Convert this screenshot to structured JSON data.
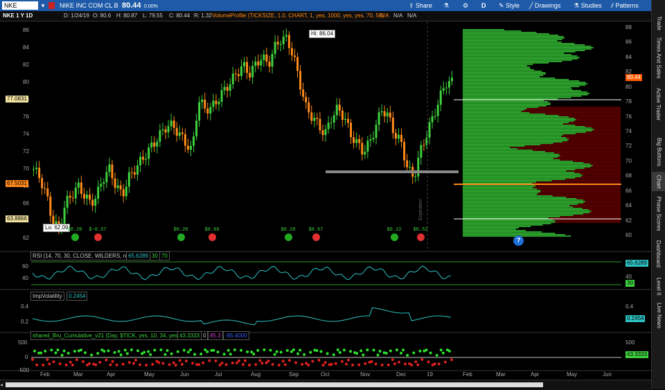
{
  "toolbar": {
    "symbol": "NKE",
    "company": "NIKE INC COM CL B",
    "last": "80.44",
    "change": "0.00%",
    "share": "Share",
    "d": "D",
    "style": "Style",
    "drawings": "Drawings",
    "studies": "Studies",
    "patterns": "Patterns"
  },
  "info": {
    "period": "NKE 1 Y 1D",
    "date": "D: 1/24/19",
    "open": "O: 80.6",
    "high": "H: 80.87",
    "low": "L: 79.55",
    "close": "C: 80.44",
    "range": "R: 1.32",
    "study": "VolumeProfile (TICKSIZE, 1.0, CHART, 1, yes, 1000, yes, yes, 70, 50)",
    "na1": "N/A",
    "na2": "N/A",
    "na3": "N/A"
  },
  "price_axis": [
    "86",
    "84",
    "82",
    "80",
    "78",
    "76",
    "74",
    "72",
    "70",
    "68",
    "66",
    "64",
    "62"
  ],
  "profile_axis": [
    "88",
    "86",
    "84",
    "82",
    "80",
    "78",
    "76",
    "74",
    "72",
    "70",
    "68",
    "66",
    "64",
    "62",
    "60"
  ],
  "tags": {
    "hi": "Hi: 86.04",
    "lo": "Lo: 62.09",
    "left1": "77.0831",
    "left2": "67.5031",
    "left3": "63.8866",
    "last": "80.44"
  },
  "dividends": [
    "$0.20",
    "$-0.57",
    "$0.20",
    "$0.69",
    "$0.20",
    "$0.67",
    "$0.22",
    "$0.52"
  ],
  "rsi": {
    "label": "RSI (14, 70, 30, CLOSE, WILDERS, no)",
    "value": "65.6289",
    "ob": "30",
    "os": "70",
    "axis": [
      "60",
      "40"
    ],
    "tag2": "30"
  },
  "iv": {
    "label": "ImpVolatility",
    "value": "0.2454",
    "axis": [
      "0.4",
      "0.2"
    ]
  },
  "tick": {
    "label": "shared_Bru_Cumulative_v21 (Day, $TICK, yes, 10, 34, yes)",
    "v1": "43.3333",
    "v2": "0",
    "v3": "85.3",
    "v4": "-85.4000",
    "axis": [
      "500",
      "0",
      "-500"
    ],
    "axis2": [
      "500",
      "0"
    ]
  },
  "months": [
    "Feb",
    "Mar",
    "Apr",
    "May",
    "Jun",
    "Jul",
    "Aug",
    "Sep",
    "Oct",
    "Nov",
    "Dec",
    "19",
    "Feb",
    "Mar",
    "Apr",
    "May",
    "Jun"
  ],
  "sidebar": [
    "Trade",
    "Times And Sales",
    "Active Trader",
    "Big Buttons",
    "Chart",
    "Phase Scores",
    "Dashboard",
    "Level II",
    "Live News"
  ],
  "expiry_label": "Expiration",
  "question": "?",
  "colors": {
    "up": "#3fd13f",
    "down": "#ff8a1a",
    "profile_green": "#33bb33",
    "profile_red": "#8b0000",
    "accent": "#1e5aa8"
  }
}
